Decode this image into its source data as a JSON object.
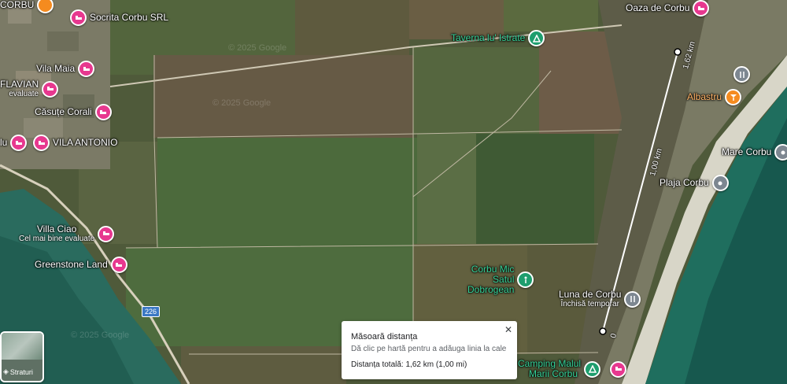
{
  "pois": {
    "corbu_top": {
      "label": "CORBU"
    },
    "socrita": {
      "label": "Socrita Corbu SRL"
    },
    "oaza": {
      "label": "Oaza de Corbu"
    },
    "taverna": {
      "label": "Taverna lu' Istrate"
    },
    "vila_maia": {
      "label": "Vila Maia"
    },
    "flavian": {
      "label": "FLAVIAN",
      "sub": "evaluate"
    },
    "casute_corali": {
      "label": "Căsuțe Corali"
    },
    "vila_antonio": {
      "label": "VILA ANTONIO"
    },
    "left_edge": {
      "label": "lu"
    },
    "albastru": {
      "label": "Albastru"
    },
    "mare_corbu": {
      "label": "Mare Corbu"
    },
    "plaja_corbu": {
      "label": "Plaja Corbu"
    },
    "villa_ciao": {
      "label": "Villa Ciao",
      "sub": "Cel mai bine evaluate"
    },
    "greenstone": {
      "label": "Greenstone Land"
    },
    "corbu_mic": {
      "label": "Corbu Mic",
      "sub1": "Satul",
      "sub2": "Dobrogean"
    },
    "luna": {
      "label": "Luna de Corbu",
      "sub": "Închisă temporar"
    },
    "camping": {
      "label": "Camping Malul",
      "sub": "Marii Corbu"
    }
  },
  "measure": {
    "title": "Măsoară distanța",
    "hint": "Dă clic pe hartă pentru a adăuga linia la cale",
    "total": "Distanța totală: 1,62 km (1,00 mi)",
    "close": "✕",
    "label_total": "1,62 km",
    "label_mid": "1,00 km",
    "label_start": "0"
  },
  "road": {
    "number": "226"
  },
  "layers": {
    "label": "Straturi"
  },
  "watermark": {
    "text": "© 2025 Google"
  },
  "colors": {
    "pink": "#e7388f",
    "green": "#1e9e6e",
    "orange": "#f58b1f",
    "sea": "#1f6e5e"
  }
}
